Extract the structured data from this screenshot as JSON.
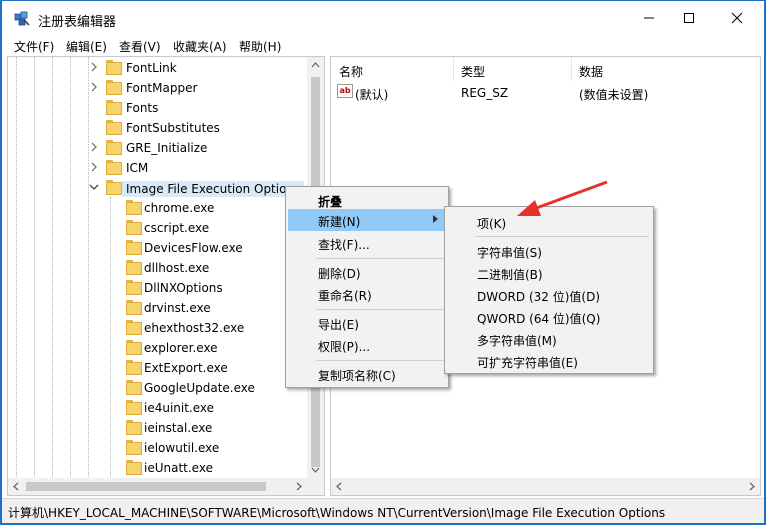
{
  "window": {
    "title": "注册表编辑器"
  },
  "menu": [
    {
      "label": "文件(F)"
    },
    {
      "label": "编辑(E)"
    },
    {
      "label": "查看(V)"
    },
    {
      "label": "收藏夹(A)"
    },
    {
      "label": "帮助(H)"
    }
  ],
  "tree": {
    "collapsed_keys": [
      "FontLink",
      "FontMapper",
      "Fonts",
      "FontSubstitutes",
      "GRE_Initialize",
      "ICM"
    ],
    "selected_key": "Image File Execution Options",
    "children": [
      "chrome.exe",
      "cscript.exe",
      "DevicesFlow.exe",
      "dllhost.exe",
      "DllNXOptions",
      "drvinst.exe",
      "ehexthost32.exe",
      "explorer.exe",
      "ExtExport.exe",
      "GoogleUpdate.exe",
      "ie4uinit.exe",
      "ieinstal.exe",
      "ielowutil.exe",
      "ieUnatt.exe"
    ]
  },
  "list": {
    "columns": [
      "名称",
      "类型",
      "数据"
    ],
    "rows": [
      {
        "name": "(默认)",
        "type": "REG_SZ",
        "data": "(数值未设置)",
        "icon": "string-value-icon"
      }
    ]
  },
  "context_menu": {
    "items": [
      "折叠",
      "新建(N)",
      "查找(F)...",
      "删除(D)",
      "重命名(R)",
      "导出(E)",
      "权限(P)...",
      "复制项名称(C)"
    ],
    "highlighted": "新建(N)"
  },
  "submenu": {
    "items": [
      "项(K)",
      "字符串值(S)",
      "二进制值(B)",
      "DWORD (32 位)值(D)",
      "QWORD (64 位)值(Q)",
      "多字符串值(M)",
      "可扩充字符串值(E)"
    ]
  },
  "statusbar": {
    "path": "计算机\\HKEY_LOCAL_MACHINE\\SOFTWARE\\Microsoft\\Windows NT\\CurrentVersion\\Image File Execution Options"
  },
  "colors": {
    "desktop": "#1a73c6",
    "highlight": "#91c9f7",
    "annotation_arrow": "#e8302c",
    "folder": "#f7d36b"
  }
}
